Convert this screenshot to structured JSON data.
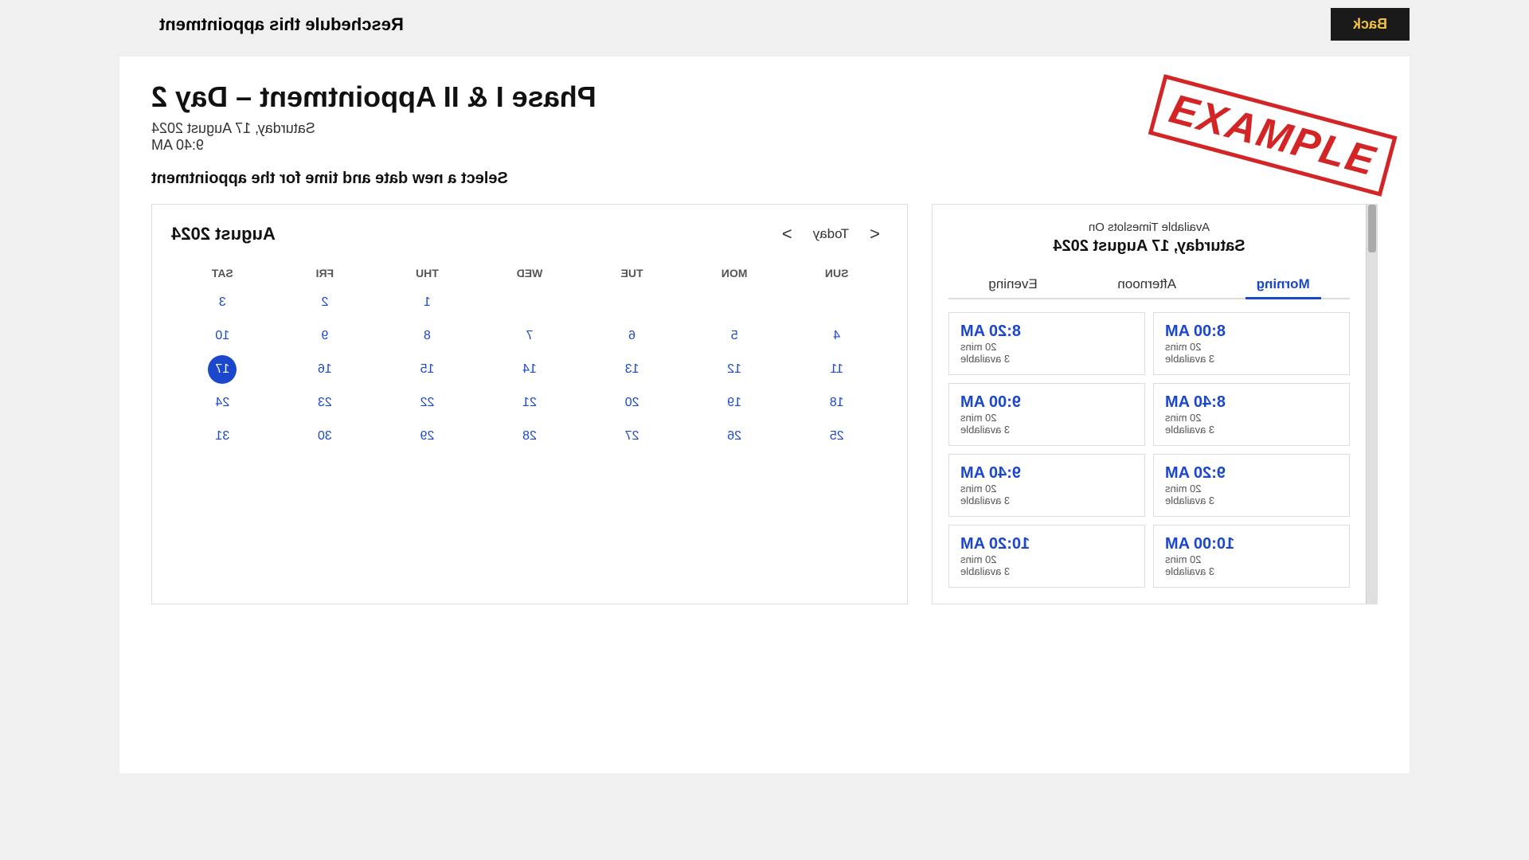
{
  "topbar": {
    "back_label": "Back",
    "page_title": "Reschedule this appointment"
  },
  "appointment": {
    "title": "Phase I & II Appointment – Day 2",
    "date": "Saturday, 17 August 2024",
    "time": "9:40 AM"
  },
  "select_label": "Select a new date and time for the appointment",
  "timeslot_panel": {
    "header": "Available Timeslots On",
    "date": "Saturday, 17 August 2024",
    "tabs": [
      "Morning",
      "Afternoon",
      "Evening"
    ],
    "active_tab": "Morning",
    "slots": [
      {
        "time": "8:00 AM",
        "duration": "20 mins",
        "available": "3 available"
      },
      {
        "time": "8:20 AM",
        "duration": "20 mins",
        "available": "3 available"
      },
      {
        "time": "8:40 AM",
        "duration": "20 mins",
        "available": "3 available"
      },
      {
        "time": "9:00 AM",
        "duration": "20 mins",
        "available": "3 available"
      },
      {
        "time": "9:20 AM",
        "duration": "20 mins",
        "available": "3 available"
      },
      {
        "time": "9:40 AM",
        "duration": "20 mins",
        "available": "3 available"
      },
      {
        "time": "10:00 AM",
        "duration": "20 mins",
        "available": "3 available"
      },
      {
        "time": "10:20 AM",
        "duration": "20 mins",
        "available": "3 available"
      }
    ]
  },
  "calendar": {
    "month_year": "August 2024",
    "today_label": "Today",
    "prev_arrow": "<",
    "next_arrow": ">",
    "days_of_week": [
      "SUN",
      "MON",
      "TUE",
      "WED",
      "THU",
      "FRI",
      "SAT"
    ],
    "selected_day": 17,
    "weeks": [
      [
        "",
        "",
        "",
        "",
        "1",
        "2",
        "3"
      ],
      [
        "4",
        "5",
        "6",
        "7",
        "8",
        "9",
        "10"
      ],
      [
        "11",
        "12",
        "13",
        "14",
        "15",
        "16",
        "17"
      ],
      [
        "18",
        "19",
        "20",
        "21",
        "22",
        "23",
        "24"
      ],
      [
        "25",
        "26",
        "27",
        "28",
        "29",
        "30",
        "31"
      ]
    ]
  },
  "example_stamp": "EXAMPLE"
}
